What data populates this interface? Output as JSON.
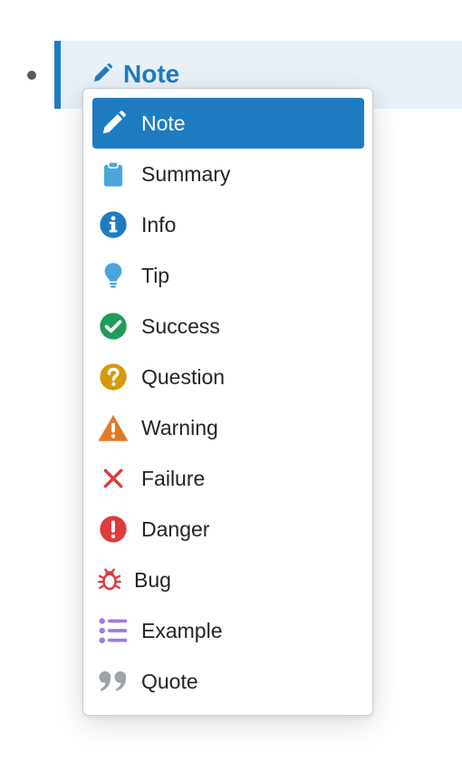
{
  "callout": {
    "title": "Note",
    "icon": "pencil-icon",
    "accent_color": "#1f7bc1",
    "background_color": "#e8f0f8"
  },
  "menu": {
    "selected_index": 0,
    "items": [
      {
        "label": "Note",
        "icon": "pencil-icon",
        "color": "#1f7bc1"
      },
      {
        "label": "Summary",
        "icon": "clipboard-icon",
        "color": "#4aa5dd"
      },
      {
        "label": "Info",
        "icon": "info-icon",
        "color": "#1f7bc1"
      },
      {
        "label": "Tip",
        "icon": "lightbulb-icon",
        "color": "#4aa5dd"
      },
      {
        "label": "Success",
        "icon": "check-circle-icon",
        "color": "#1e9c5a"
      },
      {
        "label": "Question",
        "icon": "question-circle-icon",
        "color": "#d49a0a"
      },
      {
        "label": "Warning",
        "icon": "warning-triangle-icon",
        "color": "#df7b27"
      },
      {
        "label": "Failure",
        "icon": "x-icon",
        "color": "#de3b3b"
      },
      {
        "label": "Danger",
        "icon": "exclamation-circle-icon",
        "color": "#de3b3b"
      },
      {
        "label": "Bug",
        "icon": "bug-icon",
        "color": "#de3b3b"
      },
      {
        "label": "Example",
        "icon": "list-icon",
        "color": "#9b7be0"
      },
      {
        "label": "Quote",
        "icon": "quote-icon",
        "color": "#9ea3a8"
      }
    ]
  }
}
